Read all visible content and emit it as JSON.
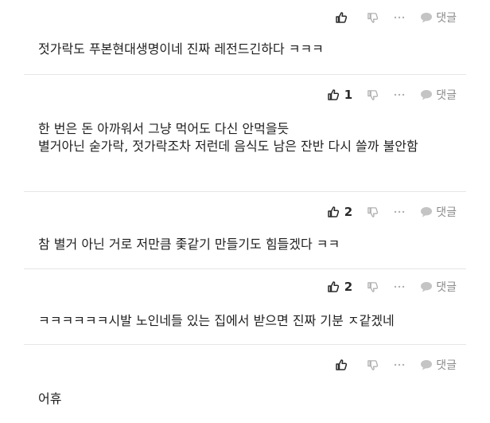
{
  "comments": [
    {
      "like_count": "",
      "reply_label": "댓글",
      "text": "젓가락도 푸본현대생명이네 진짜 레전드긴하다 ㅋㅋㅋ"
    },
    {
      "like_count": "1",
      "reply_label": "댓글",
      "text": "한 번은 돈 아까워서 그냥 먹어도 다신 안먹을듯\n별거아닌 숟가락, 젓가락조차 저런데 음식도 남은 잔반 다시 쓸까 불안함"
    },
    {
      "like_count": "2",
      "reply_label": "댓글",
      "text": "참 별거 아닌 거로 저만큼 좇같기 만들기도 힘들겠다 ㅋㅋ"
    },
    {
      "like_count": "2",
      "reply_label": "댓글",
      "text": "ㅋㅋㅋㅋㅋㅋ시발 노인네들 있는 집에서 받으면 진짜 기분 ㅈ같겠네"
    },
    {
      "like_count": "",
      "reply_label": "댓글",
      "text": "어휴"
    }
  ],
  "icons": {
    "like": "thumbs-up-icon",
    "dislike": "thumbs-down-icon",
    "more": "more-icon",
    "reply": "speech-bubble-icon"
  }
}
